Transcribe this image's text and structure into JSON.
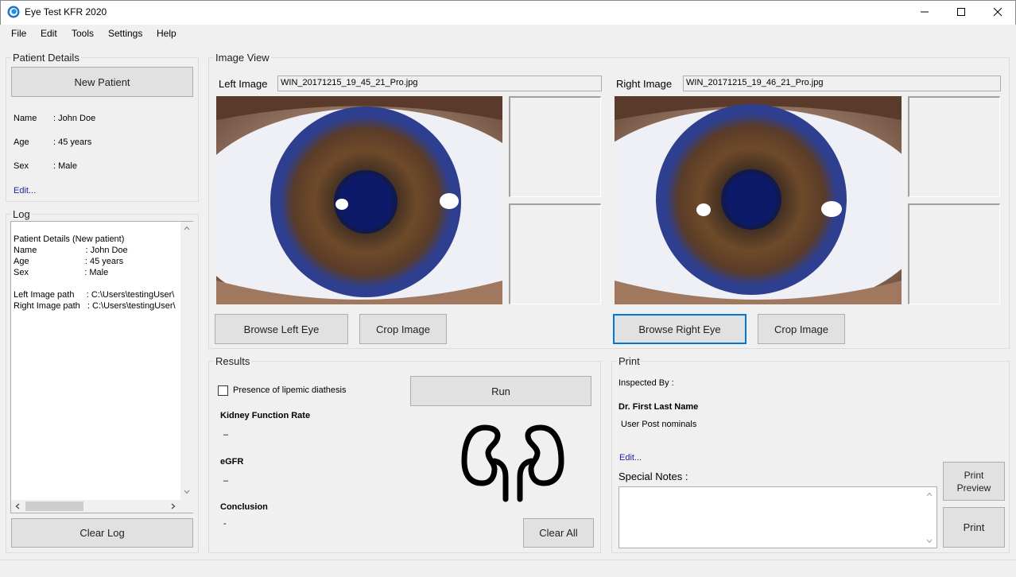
{
  "window": {
    "title": "Eye Test KFR 2020"
  },
  "menu": {
    "file": "File",
    "edit": "Edit",
    "tools": "Tools",
    "settings": "Settings",
    "help": "Help"
  },
  "patient": {
    "group_title": "Patient Details",
    "new_patient_label": "New Patient",
    "name_label": "Name",
    "name_value": ": John Doe",
    "age_label": "Age",
    "age_value": ": 45 years",
    "sex_label": "Sex",
    "sex_value": ": Male",
    "edit_link": "Edit..."
  },
  "log": {
    "group_title": "Log",
    "lines": [
      "Patient Details (New patient)",
      "Name                    : John Doe",
      "Age                       : 45 years",
      "Sex                       : Male",
      "",
      "Left Image path     : C:\\Users\\testingUser\\",
      "Right Image path   : C:\\Users\\testingUser\\"
    ],
    "clear_label": "Clear Log"
  },
  "image_view": {
    "group_title": "Image View",
    "left_label": "Left Image",
    "left_file": "WIN_20171215_19_45_21_Pro.jpg",
    "right_label": "Right Image",
    "right_file": "WIN_20171215_19_46_21_Pro.jpg",
    "browse_left_label": "Browse Left Eye",
    "crop_left_label": "Crop Image",
    "browse_right_label": "Browse Right Eye",
    "crop_right_label": "Crop Image"
  },
  "results": {
    "group_title": "Results",
    "checkbox_label": "Presence of lipemic diathesis",
    "checkbox_checked": false,
    "run_label": "Run",
    "kfr_label": "Kidney Function Rate",
    "kfr_value": "–",
    "egfr_label": "eGFR",
    "egfr_value": "–",
    "conclusion_label": "Conclusion",
    "conclusion_value": "-",
    "clear_all_label": "Clear All"
  },
  "print": {
    "group_title": "Print",
    "inspected_by_label": "Inspected By :",
    "doctor_name": "Dr. First Last Name",
    "post_nominals": "User Post nominals",
    "edit_link": "Edit...",
    "special_notes_label": "Special Notes :",
    "special_notes_value": "",
    "print_preview_label_1": "Print",
    "print_preview_label_2": "Preview",
    "print_label": "Print"
  },
  "colors": {
    "accent": "#0078d7",
    "link": "#1f1fa8",
    "iris_blue": "#2e3f8f",
    "iris_brown": "#6e4a2a"
  }
}
